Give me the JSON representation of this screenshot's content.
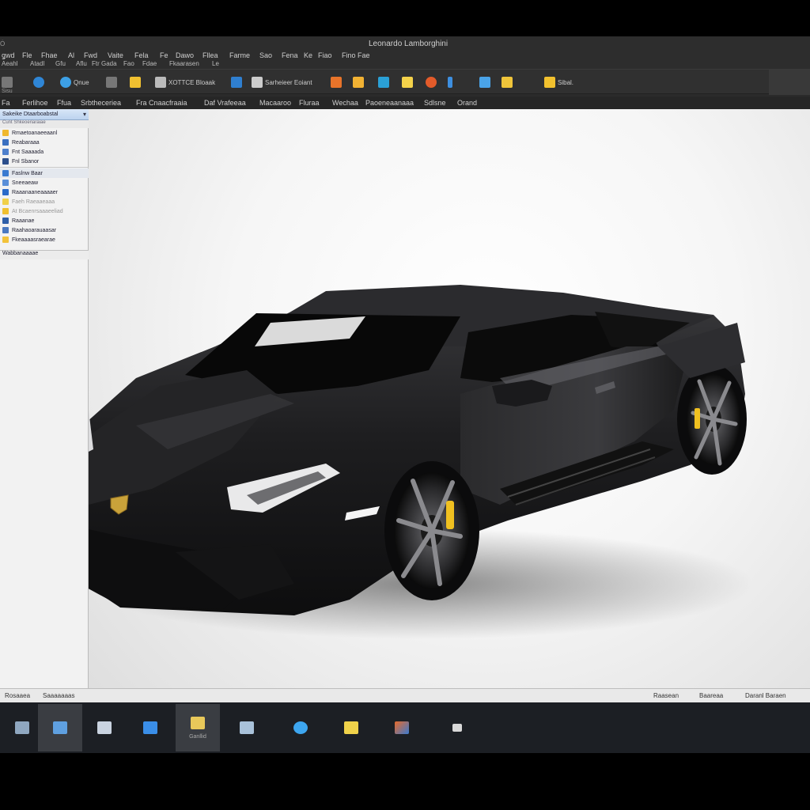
{
  "window": {
    "title": "Leonardo Lamborghini",
    "system_menu": "Ȯ"
  },
  "menubar": {
    "items": [
      "ǥwd",
      "Fle",
      "Fhae",
      "Al",
      "Fwd",
      "Vaite",
      "Fela",
      "Fe",
      "Dawo",
      "Fllea",
      "Farme",
      "Sao",
      "Fena",
      "Ke",
      "Fiao",
      "Fino",
      "Fae"
    ]
  },
  "subline": {
    "items": [
      "Aeahl",
      "Atadl",
      "Gfu",
      "Aflu",
      "Ftr Gada",
      "Fao",
      "Fdae",
      "Fkaarasen",
      "Le"
    ]
  },
  "toolbar": {
    "items": [
      {
        "label": "",
        "icon": "globe-icon",
        "color": "#2f86d6"
      },
      {
        "label": "",
        "icon": "globe-icon",
        "color": "#3da0e6"
      },
      {
        "label": "Qnue",
        "icon": "dropdown-icon",
        "color": "#777777"
      },
      {
        "label": "",
        "icon": "folder-icon",
        "color": "#f0c030"
      },
      {
        "label": "XOTTCE Bloaak",
        "icon": "tools-icon",
        "color": "#bbbbbb"
      },
      {
        "label": "",
        "icon": "window-icon",
        "color": "#2f7fd0"
      },
      {
        "label": "Sarheieer Eoiant",
        "icon": "cursor-icon",
        "color": "#cccccc"
      },
      {
        "label": "",
        "icon": "paint-icon",
        "color": "#e8742a"
      },
      {
        "label": "",
        "icon": "image-icon",
        "color": "#f2b233"
      },
      {
        "label": "",
        "icon": "cube-icon",
        "color": "#2aa0d6"
      },
      {
        "label": "",
        "icon": "document-icon",
        "color": "#f4d24a"
      },
      {
        "label": "",
        "icon": "record-icon",
        "color": "#e35b2a"
      },
      {
        "label": "",
        "icon": "bar-icon",
        "color": "#3d8fe0"
      },
      {
        "label": "",
        "icon": "monitor-icon",
        "color": "#4aa3e8"
      },
      {
        "label": "",
        "icon": "note-icon",
        "color": "#f0c53a"
      },
      {
        "label": "Sibal.",
        "icon": "wand-icon",
        "color": "#f2c12e"
      }
    ],
    "stub_label": "Sisu"
  },
  "ribbon_tabs": {
    "items": [
      "Fa",
      "Ferlihoe",
      "Ffua",
      "Srbtheceriea",
      "Fra Cnaacfraaia",
      "Daf Vrafeeaa",
      "Macaaroo",
      "Fluraa",
      "Wechaa",
      "Paoeneaanaaa",
      "Sdlsne",
      "Orand"
    ]
  },
  "panel": {
    "header": "Sakeike Dtaarboabstal",
    "dropdown_glyph": "▾",
    "subheader": "Cunt Shkeoeriaraiae",
    "items": [
      {
        "label": "Rmaetoanaeeaanl",
        "icon_color": "#f0b82e",
        "style": "normal"
      },
      {
        "label": "Reabaraaa",
        "icon_color": "#3a6fc0",
        "style": "normal"
      },
      {
        "label": "Fnt Saaaada",
        "icon_color": "#4d7fcc",
        "style": "normal"
      },
      {
        "label": "Fnl Sbanor",
        "icon_color": "#2c4f8c",
        "style": "normal"
      },
      {
        "label": "Faslnw Baar",
        "icon_color": "#3a7ad0",
        "style": "alt"
      },
      {
        "label": "Sneeaeaw",
        "icon_color": "#5a8fd8",
        "style": "normal"
      },
      {
        "label": "Raaanaaneaaaaer",
        "icon_color": "#2b6ac8",
        "style": "normal"
      },
      {
        "label": "Faeh Raeaaeaaa",
        "icon_color": "#f0d04a",
        "style": "dim"
      },
      {
        "label": "At Bcaenrsaaaeeliad",
        "icon_color": "#f0c030",
        "style": "dim"
      },
      {
        "label": "Raaanae",
        "icon_color": "#2f5fa8",
        "style": "normal"
      },
      {
        "label": "Raahaoarauaasar",
        "icon_color": "#4a78c0",
        "style": "normal"
      }
    ],
    "footer_item": "Fkeaaaasraearae",
    "footer_icon_color": "#f2c23a",
    "footer_last": "Wabbanaaaae"
  },
  "statusbar": {
    "left": "Rosaaea",
    "left2": "Saaaaaaas",
    "right1": "Raasean",
    "right2": "Baareaa",
    "right3": "Daranl Baraen"
  },
  "taskbar": {
    "items": [
      {
        "icon": "image-viewer-icon",
        "color": "#8fa7c0",
        "label": ""
      },
      {
        "icon": "window-icon",
        "color": "#5fa0e0",
        "label": "",
        "active": true
      },
      {
        "icon": "media-icon",
        "color": "#c9d3e0",
        "label": ""
      },
      {
        "icon": "network-icon",
        "color": "#3a8ee8",
        "label": ""
      },
      {
        "icon": "explorer-icon",
        "color": "#e8c85a",
        "label": "Ganllid",
        "active": true
      },
      {
        "icon": "terminal-icon",
        "color": "#a9c2da",
        "label": ""
      },
      {
        "icon": "bubble-icon",
        "color": "#3da6f0",
        "label": ""
      },
      {
        "icon": "photos-icon",
        "color": "#f0d24a",
        "label": ""
      },
      {
        "icon": "office-icon",
        "color": "#e86a2a",
        "label": ""
      },
      {
        "icon": "gadget-icon",
        "color": "#d8d8d8",
        "label": ""
      }
    ]
  },
  "colors": {
    "car_body": "#1f1f21",
    "car_highlight": "#5a5a5e",
    "caliper": "#f0c020",
    "emblem": "#c9a23a"
  }
}
